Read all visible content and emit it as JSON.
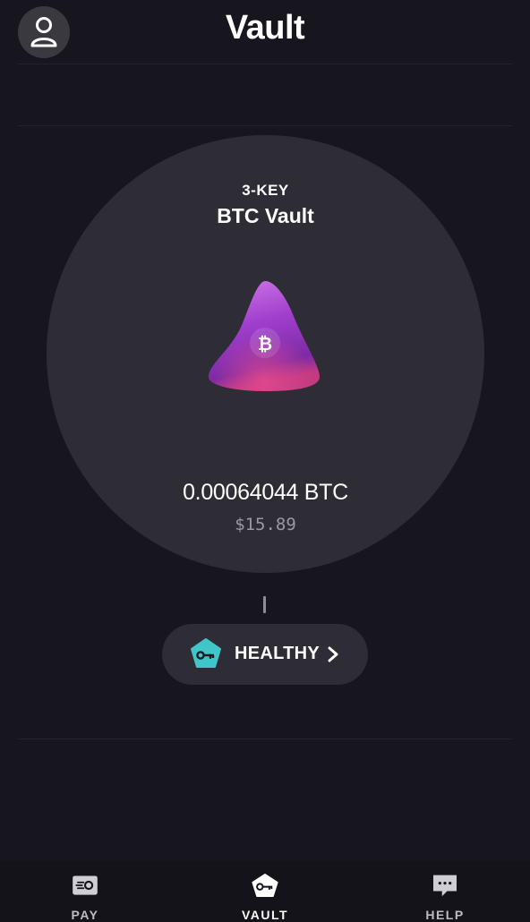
{
  "header": {
    "title": "Vault",
    "avatar_icon": "person-outline-icon"
  },
  "vault": {
    "type_label": "3-KEY",
    "name": "BTC Vault",
    "btc_balance": "0.00064044 BTC",
    "usd_balance": "$15.89",
    "graphic_icon": "bitcoin-icon",
    "accent_color": "#b24fd6"
  },
  "health": {
    "status": "HEALTHY",
    "icon": "key-pentagon-icon",
    "icon_color": "#3ec6c9"
  },
  "tabbar": {
    "tabs": [
      {
        "label": "PAY",
        "icon": "pay-card-icon",
        "active": false
      },
      {
        "label": "VAULT",
        "icon": "vault-key-icon",
        "active": true
      },
      {
        "label": "HELP",
        "icon": "chat-bubble-icon",
        "active": false
      }
    ]
  }
}
